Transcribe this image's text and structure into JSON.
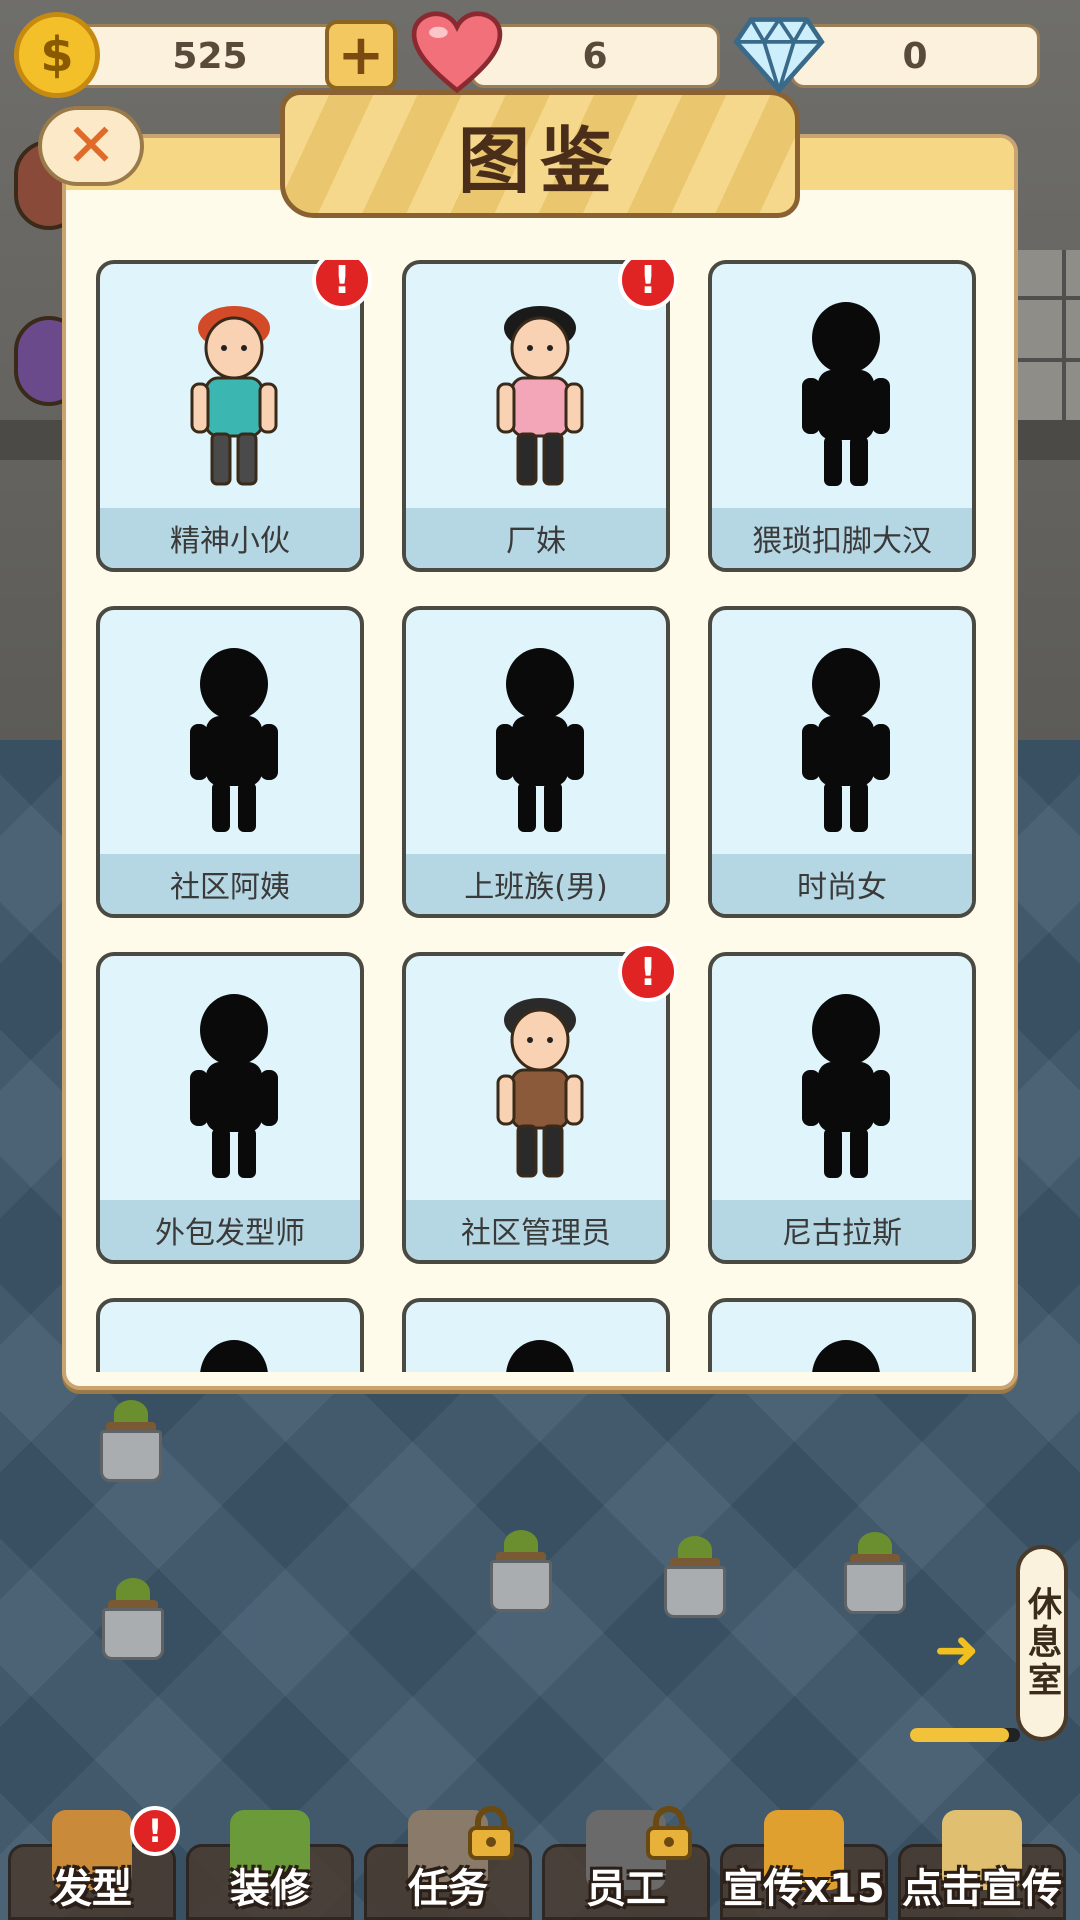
{
  "resources": {
    "coins": "525",
    "hearts": "6",
    "diamonds": "0",
    "coin_symbol": "$",
    "plus_symbol": "+"
  },
  "modal": {
    "title": "图鉴",
    "close_symbol": "✕",
    "alert_symbol": "!",
    "cards": [
      {
        "name": "精神小伙",
        "unlocked": true,
        "new": true
      },
      {
        "name": "厂妹",
        "unlocked": true,
        "new": true
      },
      {
        "name": "猥琐扣脚大汉",
        "unlocked": false,
        "new": false
      },
      {
        "name": "社区阿姨",
        "unlocked": false,
        "new": false
      },
      {
        "name": "上班族(男)",
        "unlocked": false,
        "new": false
      },
      {
        "name": "时尚女",
        "unlocked": false,
        "new": false
      },
      {
        "name": "外包发型师",
        "unlocked": false,
        "new": false
      },
      {
        "name": "社区管理员",
        "unlocked": true,
        "new": true
      },
      {
        "name": "尼古拉斯",
        "unlocked": false,
        "new": false
      },
      {
        "name": "",
        "unlocked": false,
        "new": false
      },
      {
        "name": "",
        "unlocked": false,
        "new": false
      },
      {
        "name": "",
        "unlocked": false,
        "new": false
      }
    ]
  },
  "rest_room": {
    "label": "休息室",
    "progress": 0.9
  },
  "bottom_nav": [
    {
      "label": "发型",
      "locked": false,
      "badge": "!"
    },
    {
      "label": "装修",
      "locked": false,
      "badge": ""
    },
    {
      "label": "任务",
      "locked": true,
      "badge": ""
    },
    {
      "label": "员工",
      "locked": true,
      "badge": ""
    },
    {
      "label": "宣传x15",
      "locked": false,
      "badge": ""
    },
    {
      "label": "点击宣传",
      "locked": false,
      "badge": ""
    }
  ],
  "colors": {
    "card_bg": "#dff4fb",
    "card_label_bg": "#b5d7e4",
    "badge_red": "#e02424",
    "banner": "#f3cf72",
    "modal_bg": "#fffbea"
  }
}
